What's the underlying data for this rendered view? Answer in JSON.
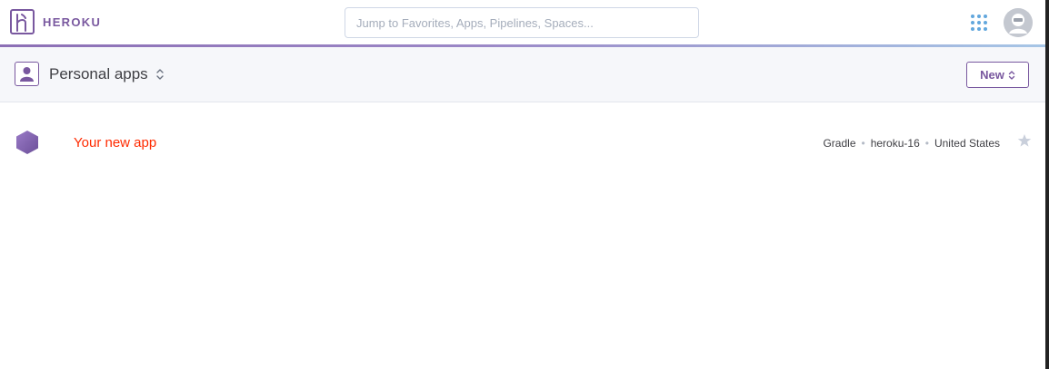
{
  "brand": {
    "name": "HEROKU",
    "color": "#79589f"
  },
  "search": {
    "placeholder": "Jump to Favorites, Apps, Pipelines, Spaces..."
  },
  "header": {
    "apps_icon": "grid-dots-icon",
    "avatar_icon": "user-avatar-icon"
  },
  "context": {
    "title": "Personal apps",
    "icon": "person-icon",
    "switcher_icon": "up-down-caret-icon"
  },
  "toolbar": {
    "new_label": "New"
  },
  "apps": [
    {
      "name": "Your new app",
      "language": "Gradle",
      "stack": "heroku-16",
      "region": "United States",
      "separator": "•",
      "icon": "hexagon-app-icon",
      "favorite_icon": "star-icon",
      "favorited": false
    }
  ],
  "colors": {
    "accent": "#79589f",
    "app_name": "#ff2a00",
    "link_blue": "#62a7dd"
  }
}
